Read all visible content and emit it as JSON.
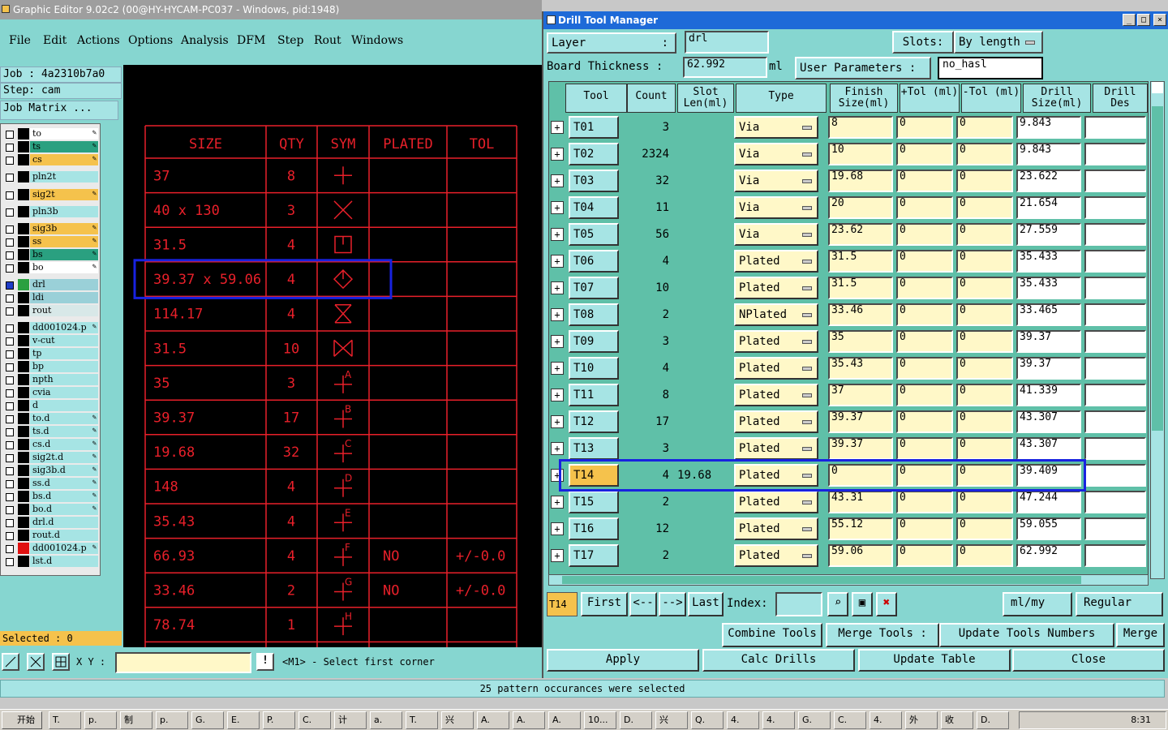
{
  "main_window": {
    "title": "Graphic Editor 9.02c2 (00@HY-HYCAM-PC037 - Windows, pid:1948)",
    "menu": [
      "File",
      "Edit",
      "Actions",
      "Options",
      "Analysis",
      "DFM",
      "Step",
      "Rout",
      "Windows"
    ],
    "job": "Job : 4a2310b7a0",
    "step": "Step: cam",
    "job_matrix": "Job Matrix ...",
    "layers": [
      {
        "name": "to",
        "color": "#ffffff",
        "pen": true
      },
      {
        "name": "ts",
        "color": "#2aa080",
        "pen": true
      },
      {
        "name": "cs",
        "color": "#f5c24c",
        "pen": true
      },
      {
        "name": "pln2t",
        "color": "#a6e4e4",
        "pen": false
      },
      {
        "name": "sig2t",
        "color": "#f5c24c",
        "pen": true
      },
      {
        "name": "pln3b",
        "color": "#a6e4e4",
        "pen": false
      },
      {
        "name": "sig3b",
        "color": "#f5c24c",
        "pen": true
      },
      {
        "name": "ss",
        "color": "#f5c24c",
        "pen": true
      },
      {
        "name": "bs",
        "color": "#2aa080",
        "pen": true
      },
      {
        "name": "bo",
        "color": "#ffffff",
        "pen": true
      },
      {
        "name": "drl",
        "color": "#9ad0d8",
        "pen": false
      },
      {
        "name": "ldi",
        "color": "#9ad0d8",
        "pen": false
      },
      {
        "name": "rout",
        "color": "#d8e8e8",
        "pen": false
      },
      {
        "name": "dd001024.p",
        "color": "#a6e4e4",
        "pen": true
      },
      {
        "name": "v-cut",
        "color": "#a6e4e4",
        "pen": false
      },
      {
        "name": "tp",
        "color": "#a6e4e4",
        "pen": false
      },
      {
        "name": "bp",
        "color": "#a6e4e4",
        "pen": false
      },
      {
        "name": "npth",
        "color": "#a6e4e4",
        "pen": false
      },
      {
        "name": "cvia",
        "color": "#a6e4e4",
        "pen": false
      },
      {
        "name": "d",
        "color": "#a6e4e4",
        "pen": false
      },
      {
        "name": "to.d",
        "color": "#a6e4e4",
        "pen": true
      },
      {
        "name": "ts.d",
        "color": "#a6e4e4",
        "pen": true
      },
      {
        "name": "cs.d",
        "color": "#a6e4e4",
        "pen": true
      },
      {
        "name": "sig2t.d",
        "color": "#a6e4e4",
        "pen": true
      },
      {
        "name": "sig3b.d",
        "color": "#a6e4e4",
        "pen": true
      },
      {
        "name": "ss.d",
        "color": "#a6e4e4",
        "pen": true
      },
      {
        "name": "bs.d",
        "color": "#a6e4e4",
        "pen": true
      },
      {
        "name": "bo.d",
        "color": "#a6e4e4",
        "pen": true
      },
      {
        "name": "drl.d",
        "color": "#a6e4e4",
        "pen": false
      },
      {
        "name": "rout.d",
        "color": "#a6e4e4",
        "pen": false
      },
      {
        "name": "dd001024.p",
        "color": "#a6e4e4",
        "pen": true
      },
      {
        "name": "lst.d",
        "color": "#a6e4e4",
        "pen": false
      }
    ],
    "selected": "Selected : 0",
    "xy_label": "X Y :",
    "prompt": "<M1> - Select first corner",
    "drill_chart": {
      "headers": [
        "SIZE",
        "QTY",
        "SYM",
        "PLATED",
        "TOL"
      ],
      "rows": [
        [
          "37",
          "8",
          "plus",
          "",
          ""
        ],
        [
          "40 x 130",
          "3",
          "x",
          "",
          ""
        ],
        [
          "31.5",
          "4",
          "box",
          "",
          ""
        ],
        [
          "39.37 x 59.06",
          "4",
          "diamond",
          "",
          ""
        ],
        [
          "114.17",
          "4",
          "hourglass",
          "",
          ""
        ],
        [
          "31.5",
          "10",
          "bowtie",
          "",
          ""
        ],
        [
          "35",
          "3",
          "A",
          "",
          ""
        ],
        [
          "39.37",
          "17",
          "B",
          "",
          ""
        ],
        [
          "19.68",
          "32",
          "C",
          "",
          ""
        ],
        [
          "148",
          "4",
          "D",
          "",
          ""
        ],
        [
          "35.43",
          "4",
          "E",
          "",
          ""
        ],
        [
          "66.93",
          "4",
          "F",
          "NO",
          "+/-0.0"
        ],
        [
          "33.46",
          "2",
          "G",
          "NO",
          "+/-0.0"
        ],
        [
          "78.74",
          "1",
          "H",
          "",
          ""
        ]
      ]
    }
  },
  "status": "25 pattern occurances were selected",
  "drill_window": {
    "title": "Drill Tool Manager",
    "layer_label": "Layer",
    "layer_value": "drl",
    "slots_label": "Slots:",
    "slots_value": "By length",
    "board_thickness_label": "Board Thickness :",
    "board_thickness_value": "62.992",
    "board_thickness_unit": "ml",
    "user_params_label": "User Parameters :",
    "user_params_value": "no_hasl",
    "columns": [
      "Tool",
      "Count",
      "Slot Len(ml)",
      "Type",
      "Finish Size(ml)",
      "+Tol (ml)",
      "-Tol (ml)",
      "Drill Size(ml)",
      "Drill Des"
    ],
    "rows": [
      {
        "tool": "T01",
        "count": "3",
        "slot": "",
        "type": "Via",
        "finish": "8",
        "ptol": "0",
        "mtol": "0",
        "drill": "9.843"
      },
      {
        "tool": "T02",
        "count": "2324",
        "slot": "",
        "type": "Via",
        "finish": "10",
        "ptol": "0",
        "mtol": "0",
        "drill": "9.843"
      },
      {
        "tool": "T03",
        "count": "32",
        "slot": "",
        "type": "Via",
        "finish": "19.68",
        "ptol": "0",
        "mtol": "0",
        "drill": "23.622"
      },
      {
        "tool": "T04",
        "count": "11",
        "slot": "",
        "type": "Via",
        "finish": "20",
        "ptol": "0",
        "mtol": "0",
        "drill": "21.654"
      },
      {
        "tool": "T05",
        "count": "56",
        "slot": "",
        "type": "Via",
        "finish": "23.62",
        "ptol": "0",
        "mtol": "0",
        "drill": "27.559"
      },
      {
        "tool": "T06",
        "count": "4",
        "slot": "",
        "type": "Plated",
        "finish": "31.5",
        "ptol": "0",
        "mtol": "0",
        "drill": "35.433"
      },
      {
        "tool": "T07",
        "count": "10",
        "slot": "",
        "type": "Plated",
        "finish": "31.5",
        "ptol": "0",
        "mtol": "0",
        "drill": "35.433"
      },
      {
        "tool": "T08",
        "count": "2",
        "slot": "",
        "type": "NPlated",
        "finish": "33.46",
        "ptol": "0",
        "mtol": "0",
        "drill": "33.465"
      },
      {
        "tool": "T09",
        "count": "3",
        "slot": "",
        "type": "Plated",
        "finish": "35",
        "ptol": "0",
        "mtol": "0",
        "drill": "39.37"
      },
      {
        "tool": "T10",
        "count": "4",
        "slot": "",
        "type": "Plated",
        "finish": "35.43",
        "ptol": "0",
        "mtol": "0",
        "drill": "39.37"
      },
      {
        "tool": "T11",
        "count": "8",
        "slot": "",
        "type": "Plated",
        "finish": "37",
        "ptol": "0",
        "mtol": "0",
        "drill": "41.339"
      },
      {
        "tool": "T12",
        "count": "17",
        "slot": "",
        "type": "Plated",
        "finish": "39.37",
        "ptol": "0",
        "mtol": "0",
        "drill": "43.307"
      },
      {
        "tool": "T13",
        "count": "3",
        "slot": "",
        "type": "Plated",
        "finish": "39.37",
        "ptol": "0",
        "mtol": "0",
        "drill": "43.307"
      },
      {
        "tool": "T14",
        "count": "4",
        "slot": "19.68",
        "type": "Plated",
        "finish": "0",
        "ptol": "0",
        "mtol": "0",
        "drill": "39.409",
        "selected": true
      },
      {
        "tool": "T15",
        "count": "2",
        "slot": "",
        "type": "Plated",
        "finish": "43.31",
        "ptol": "0",
        "mtol": "0",
        "drill": "47.244"
      },
      {
        "tool": "T16",
        "count": "12",
        "slot": "",
        "type": "Plated",
        "finish": "55.12",
        "ptol": "0",
        "mtol": "0",
        "drill": "59.055"
      },
      {
        "tool": "T17",
        "count": "2",
        "slot": "",
        "type": "Plated",
        "finish": "59.06",
        "ptol": "0",
        "mtol": "0",
        "drill": "62.992"
      }
    ],
    "current_tool": "T14",
    "nav": {
      "first": "First",
      "prev": "<--",
      "next": "-->",
      "last": "Last",
      "index_label": "Index:"
    },
    "units": "ml/my",
    "mode": "Regular",
    "combine": "Combine Tools",
    "merge_tools": "Merge Tools :",
    "update_numbers": "Update Tools Numbers",
    "merge": "Merge",
    "apply": "Apply",
    "calc": "Calc Drills",
    "update_table": "Update Table",
    "close": "Close"
  },
  "taskbar": {
    "start": "开始",
    "items": [
      "T.",
      "p.",
      "制",
      "p.",
      "G.",
      "E.",
      "P.",
      "C.",
      "计",
      "a.",
      "T.",
      "兴",
      "A.",
      "A.",
      "A.",
      "10...",
      "D.",
      "兴",
      "Q.",
      "4.",
      "4.",
      "G.",
      "C.",
      "4.",
      "外",
      "收",
      "D."
    ],
    "clock": "8:31"
  }
}
